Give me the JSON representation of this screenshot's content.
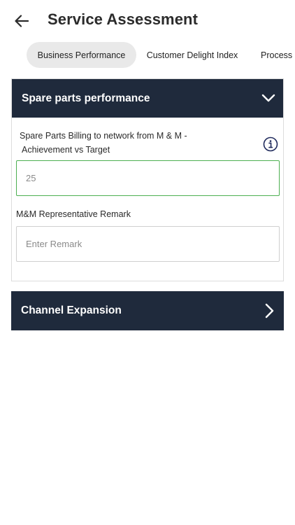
{
  "header": {
    "title": "Service Assessment",
    "back_icon": "arrow-left-icon"
  },
  "tabs": [
    {
      "label": "Business Performance",
      "active": true
    },
    {
      "label": "Customer Delight Index",
      "active": false
    },
    {
      "label": "Process Ex",
      "active": false
    }
  ],
  "sections": {
    "spare_parts": {
      "title": "Spare parts performance",
      "expanded": true,
      "chevron_icon": "chevron-down-icon",
      "question_line1": "Spare Parts Billing to network from M & M  -",
      "question_line2": "Achievement vs Target",
      "info_icon": "info-circle-icon",
      "achievement_value": "25",
      "remark_label": "M&M Representative Remark",
      "remark_placeholder": "Enter Remark",
      "remark_value": ""
    },
    "channel_expansion": {
      "title": "Channel Expansion",
      "expanded": false,
      "chevron_icon": "chevron-right-icon"
    }
  },
  "colors": {
    "header_bg": "#1f2a3c",
    "active_tab_bg": "#e9e9e9",
    "focus_border": "#4caf50",
    "info_icon": "#1f2a5c"
  }
}
